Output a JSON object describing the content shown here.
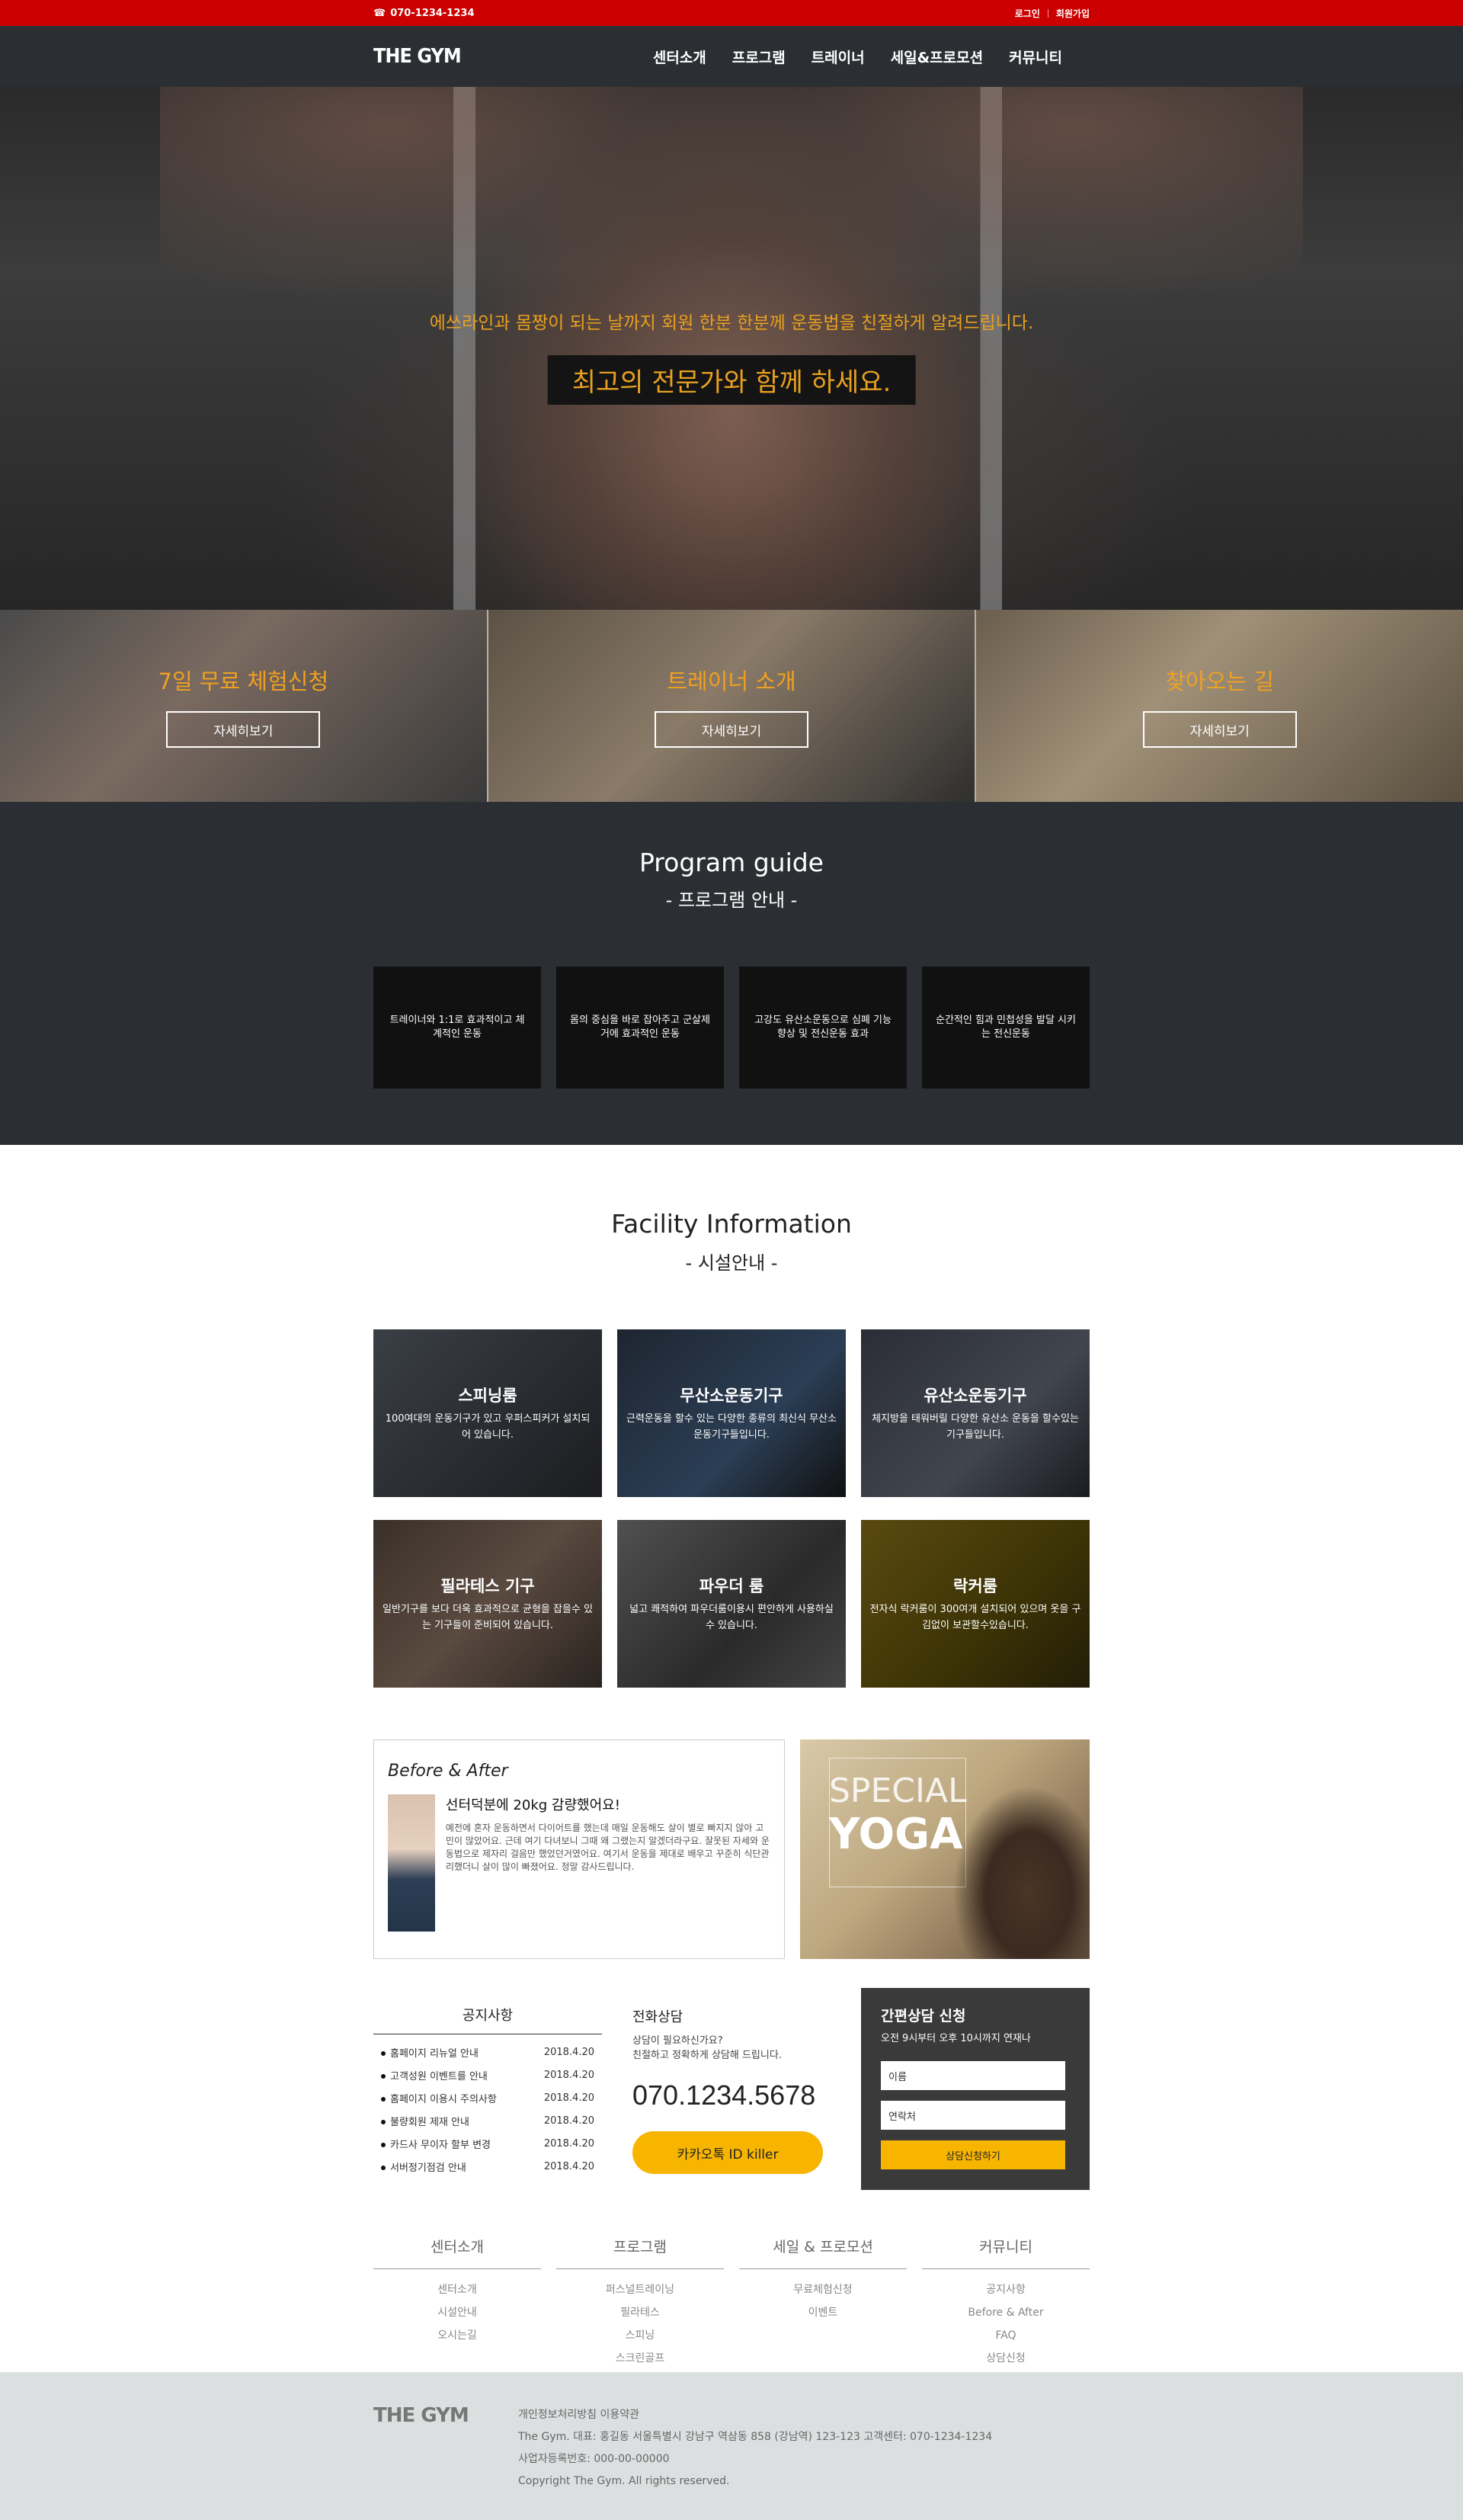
{
  "topbar": {
    "phone": "070-1234-1234",
    "login": "로그인",
    "signup": "회원가입"
  },
  "nav": {
    "logo": "THE GYM",
    "items": [
      "센터소개",
      "프로그램",
      "트레이너",
      "세일&프로모션",
      "커뮤니티"
    ]
  },
  "hero": {
    "subtitle": "에쓰라인과 몸짱이 되는 날까지 회원 한분 한분께 운동법을 친절하게 알려드립니다.",
    "title": "최고의 전문가와 함께 하세요."
  },
  "features": [
    {
      "title": "7일 무료 체험신청",
      "button": "자세히보기"
    },
    {
      "title": "트레이너 소개",
      "button": "자세히보기"
    },
    {
      "title": "찾아오는 길",
      "button": "자세히보기"
    }
  ],
  "program": {
    "title": "Program guide",
    "subtitle": "- 프로그램 안내 -",
    "items": [
      "트레이너와 1:1로 효과적이고 체계적인 운동",
      "몸의 중심을 바로 잡아주고 군살제거에 효과적인 운동",
      "고강도 유산소운동으로 심폐 기능 향상 및 전신운동 효과",
      "순간적인 힘과 민첩성을 발달 시키는 전신운동"
    ]
  },
  "facility": {
    "title": "Facility Information",
    "subtitle": "- 시설안내 -",
    "items": [
      {
        "title": "스피닝룸",
        "desc": "100여대의 운동기구가 있고 우퍼스피커가 설치되어 있습니다."
      },
      {
        "title": "무산소운동기구",
        "desc": "근력운동을 할수 있는 다양한 종류의 최신식 무산소 운동기구들입니다."
      },
      {
        "title": "유산소운동기구",
        "desc": "체지방을 태워버릴 다양한 유산소 운동을 할수있는 기구들입니다."
      },
      {
        "title": "필라테스 기구",
        "desc": "일반기구를 보다 더욱 효과적으로 균형을 잡을수 있는 기구들이 준비되어 있습니다."
      },
      {
        "title": "파우더 룸",
        "desc": "넓고 쾌적하여 파우더룸이용시 편안하게 사용하실 수 있습니다."
      },
      {
        "title": "락커룸",
        "desc": "전자식 락커룸이 300여개 설치되어 있으며 옷을 구김없이 보관할수있습니다."
      }
    ]
  },
  "before_after": {
    "heading": "Before & After",
    "title": "선터덕분에 20kg 감량했어요!",
    "body": "예전에 혼자 운동하면서 다이어트를 했는데 매일 운동해도 살이 별로 빠지지 않아 고민이 많았어요. 근데 여기 다녀보니 그때 왜 그랬는지 알겠더라구요. 잘못된 자세와 운동법으로 제자리 걸음만 했었던거였어요. 여기서 운동을 제대로 배우고 꾸준히 식단관리했더니 살이 많이 빠졌어요. 정말 감사드립니다."
  },
  "yoga": {
    "line1": "SPECIAL",
    "line2": "YOGA"
  },
  "notice": {
    "title": "공지사항",
    "items": [
      {
        "text": "홈페이지 리뉴얼 안내",
        "date": "2018.4.20"
      },
      {
        "text": "고객성원 이벤트를 안내",
        "date": "2018.4.20"
      },
      {
        "text": "홈페이지 이용시 주의사항",
        "date": "2018.4.20"
      },
      {
        "text": "불량회원 제재 안내",
        "date": "2018.4.20"
      },
      {
        "text": "카드사 무이자 할부 변경",
        "date": "2018.4.20"
      },
      {
        "text": "서버정기점검 안내",
        "date": "2018.4.20"
      }
    ]
  },
  "phone_consult": {
    "title": "전화상담",
    "desc1": "상담이 필요하신가요?",
    "desc2": "친절하고 정확하게 상담해 드립니다.",
    "number": "070.1234.5678",
    "kakao": "카카오톡 ID killer"
  },
  "quick_consult": {
    "title": "간편상담 신청",
    "desc": "오전 9시부터 오후 10시까지 연재나",
    "name_placeholder": "이름",
    "contact_placeholder": "연락처",
    "button": "상담신청하기"
  },
  "sitemap": [
    {
      "title": "센터소개",
      "links": [
        "센터소개",
        "시설안내",
        "오시는길"
      ]
    },
    {
      "title": "프로그램",
      "links": [
        "퍼스널트레이닝",
        "필라테스",
        "스피닝",
        "스크린골프"
      ]
    },
    {
      "title": "세일 & 프로모션",
      "links": [
        "무료체험신청",
        "이벤트"
      ]
    },
    {
      "title": "커뮤니티",
      "links": [
        "공지사항",
        "Before & After",
        "FAQ",
        "상담신청"
      ]
    }
  ],
  "footer": {
    "logo": "THE GYM",
    "line1": "개인정보처리방침 이용약관",
    "line2": "The Gym. 대표: 홍길동      서울특별시 강남구 역삼동 858 (강남역) 123-123   고객센터: 070-1234-1234",
    "line3": "사업자등록번호: 000-00-00000",
    "line4": "Copyright The Gym. All rights reserved."
  }
}
